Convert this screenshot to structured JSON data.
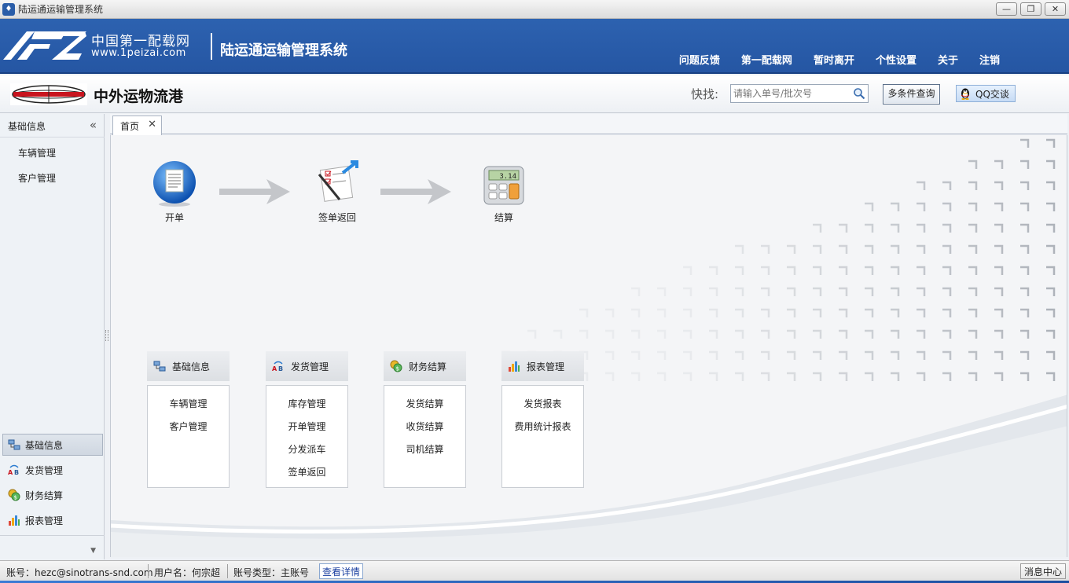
{
  "window": {
    "title": "陆运通运输管理系统",
    "buttons": [
      "—",
      "❐",
      "✕"
    ]
  },
  "header": {
    "logo_cn": "中国第一配载网",
    "logo_url": "www.1peizai.com",
    "system_name": "陆运通运输管理系统",
    "nav": [
      "问题反馈",
      "第一配载网",
      "暂时离开",
      "个性设置",
      "关于",
      "注销"
    ]
  },
  "company": {
    "name": "中外运物流港",
    "quick_label": "快找:",
    "search_placeholder": "请输入单号/批次号",
    "multi_query": "多条件查询",
    "qq_chat": "QQ交谈"
  },
  "sidebar": {
    "title": "基础信息",
    "collapse": "«",
    "items": [
      "车辆管理",
      "客户管理"
    ],
    "nav": [
      {
        "label": "基础信息",
        "active": true
      },
      {
        "label": "发货管理",
        "active": false
      },
      {
        "label": "财务结算",
        "active": false
      },
      {
        "label": "报表管理",
        "active": false
      }
    ],
    "more": "▼"
  },
  "tabs": [
    {
      "label": "首页",
      "close": "✕"
    }
  ],
  "flow": [
    "开单",
    "签单返回",
    "结算"
  ],
  "calculator_display": "3.14",
  "panels": [
    {
      "title": "基础信息",
      "items": [
        "车辆管理",
        "客户管理"
      ]
    },
    {
      "title": "发货管理",
      "items": [
        "库存管理",
        "开单管理",
        "分发派车",
        "签单返回"
      ]
    },
    {
      "title": "财务结算",
      "items": [
        "发货结算",
        "收货结算",
        "司机结算"
      ]
    },
    {
      "title": "报表管理",
      "items": [
        "发货报表",
        "费用统计报表"
      ]
    }
  ],
  "status": {
    "account": "账号：hezc@sinotrans-snd.com",
    "username": "用户名：何宗超",
    "account_type": "账号类型：主账号",
    "details_link": "查看详情",
    "message_center": "消息中心"
  },
  "colors": {
    "header_blue": "#2a5ca9",
    "link_blue": "#1a3fa0"
  }
}
